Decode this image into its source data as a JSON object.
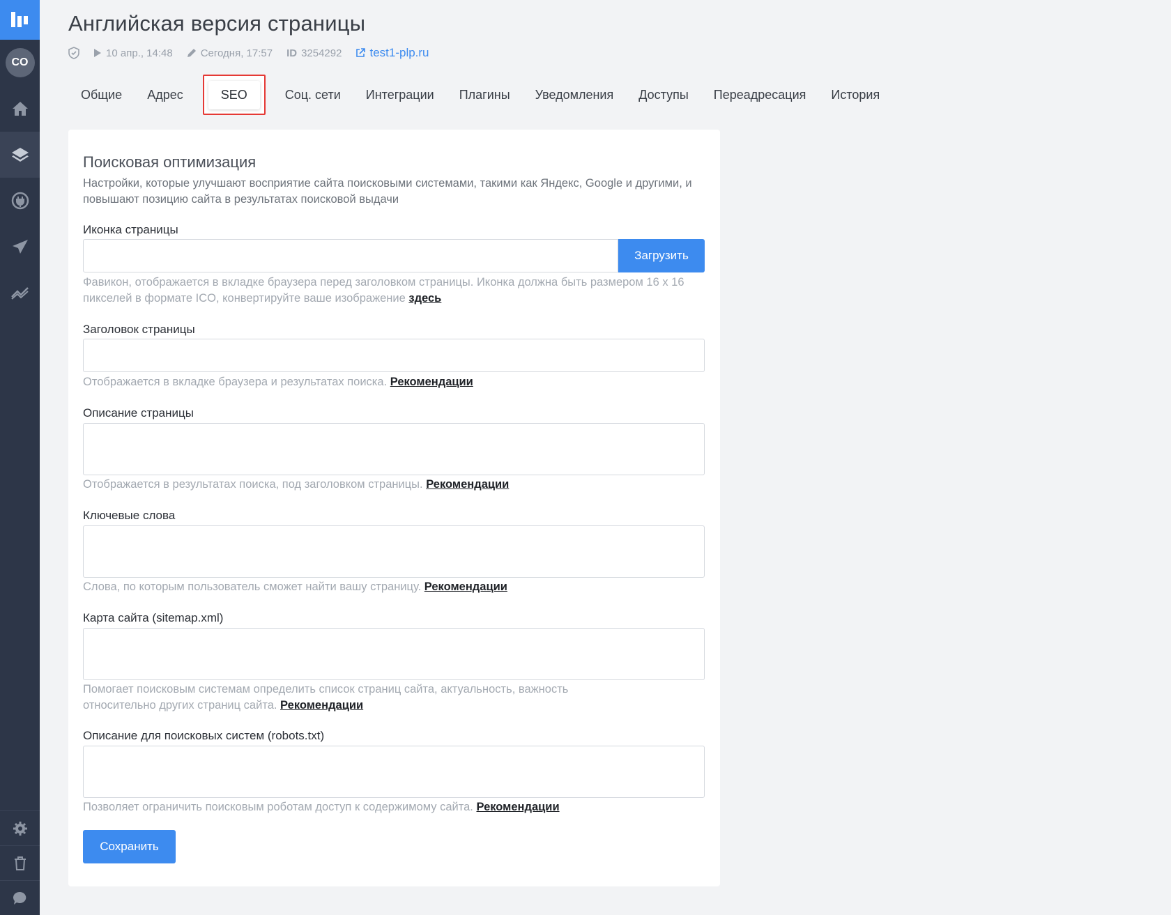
{
  "sidebar": {
    "avatar_initials": "CO",
    "items": [
      "home-icon",
      "layers-icon",
      "plug-icon",
      "send-icon",
      "analytics-icon"
    ],
    "bottom_items": [
      "gear-icon",
      "trash-icon",
      "chat-icon"
    ]
  },
  "header": {
    "title": "Английская версия страницы",
    "published": "10 апр., 14:48",
    "edited": "Сегодня, 17:57",
    "id_label": "ID",
    "id_value": "3254292",
    "site_link": "test1-plp.ru"
  },
  "tabs": [
    {
      "label": "Общие"
    },
    {
      "label": "Адрес"
    },
    {
      "label": "SEO"
    },
    {
      "label": "Соц. сети"
    },
    {
      "label": "Интеграции"
    },
    {
      "label": "Плагины"
    },
    {
      "label": "Уведомления"
    },
    {
      "label": "Доступы"
    },
    {
      "label": "Переадресация"
    },
    {
      "label": "История"
    }
  ],
  "seo": {
    "title": "Поисковая оптимизация",
    "description": "Настройки, которые улучшают восприятие сайта поисковыми системами, такими как Яндекс, Google и другими, и повышают позицию сайта в результатах поисковой выдачи",
    "favicon": {
      "label": "Иконка страницы",
      "upload_label": "Загрузить",
      "hint": "Фавикон, отображается в вкладке браузера перед заголовком страницы. Иконка должна быть размером 16 х 16 пикселей в формате ICO, конвертируйте ваше изображение ",
      "hint_link": "здесь"
    },
    "page_title": {
      "label": "Заголовок страницы",
      "hint": "Отображается в вкладке браузера и результатах поиска. ",
      "hint_link": "Рекомендации"
    },
    "page_description": {
      "label": "Описание страницы",
      "hint": "Отображается в результатах поиска, под заголовком страницы. ",
      "hint_link": "Рекомендации"
    },
    "keywords": {
      "label": "Ключевые слова",
      "hint": "Слова, по которым пользователь сможет найти вашу страницу. ",
      "hint_link": "Рекомендации"
    },
    "sitemap": {
      "label": "Карта сайта (sitemap.xml)",
      "hint": "Помогает поисковым системам определить список страниц сайта, актуальность, важность относительно других страниц сайта. ",
      "hint_link": "Рекомендации"
    },
    "robots": {
      "label": "Описание для поисковых систем (robots.txt)",
      "hint": "Позволяет ограничить поисковым роботам доступ к содержимому сайта. ",
      "hint_link": "Рекомендации"
    },
    "save_label": "Сохранить"
  },
  "colors": {
    "accent": "#3d8bef",
    "sidebar": "#2d3648",
    "highlight": "#e53935"
  }
}
